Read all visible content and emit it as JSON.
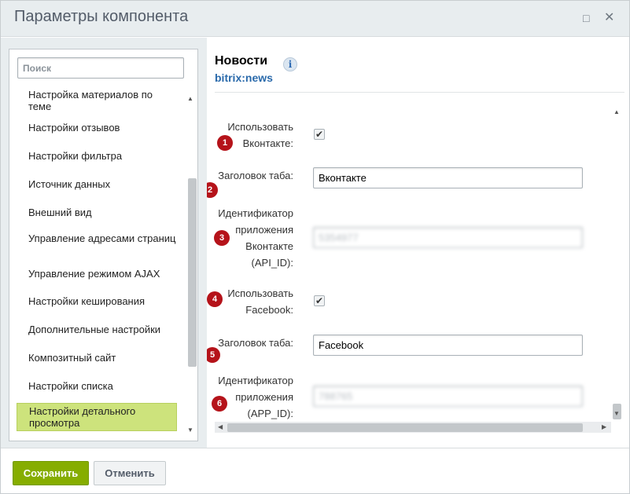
{
  "window": {
    "title": "Параметры компонента",
    "maximize_icon": "□",
    "close_icon": "✕"
  },
  "search": {
    "placeholder": "Поиск"
  },
  "sidebar": {
    "items": [
      {
        "label": "Настройка материалов по теме"
      },
      {
        "label": "Настройки отзывов"
      },
      {
        "label": "Настройки фильтра"
      },
      {
        "label": "Источник данных"
      },
      {
        "label": "Внешний вид"
      },
      {
        "label": "Управление адресами страниц"
      },
      {
        "label": "Управление режимом AJAX"
      },
      {
        "label": "Настройки кеширования"
      },
      {
        "label": "Дополнительные настройки"
      },
      {
        "label": "Композитный сайт"
      },
      {
        "label": "Настройки списка"
      },
      {
        "label": "Настройки детального просмотра",
        "active": true
      }
    ]
  },
  "component": {
    "title": "Новости",
    "info_icon": "i",
    "code": "bitrix:news"
  },
  "form": {
    "use_vk_label": "Использовать Вконтакте:",
    "use_vk_checked": true,
    "vk_tab_title_label": "Заголовок таба:",
    "vk_tab_title_value": "Вконтакте",
    "vk_api_id_label": "Идентификатор приложения Вконтакте (API_ID):",
    "vk_api_id_value": "5354977",
    "use_fb_label": "Использовать Facebook:",
    "use_fb_checked": true,
    "fb_tab_title_label": "Заголовок таба:",
    "fb_tab_title_value": "Facebook",
    "fb_app_id_label": "Идентификатор приложения (APP_ID):",
    "fb_app_id_value": "788765"
  },
  "badges": [
    "1",
    "2",
    "3",
    "4",
    "5",
    "6"
  ],
  "checkmark": "✔",
  "footer": {
    "save_label": "Сохранить",
    "cancel_label": "Отменить"
  },
  "colors": {
    "save_button": "#86ad00",
    "active_item": "#cde37c",
    "badge": "#b5131a",
    "link_blue": "#2a6aab"
  }
}
